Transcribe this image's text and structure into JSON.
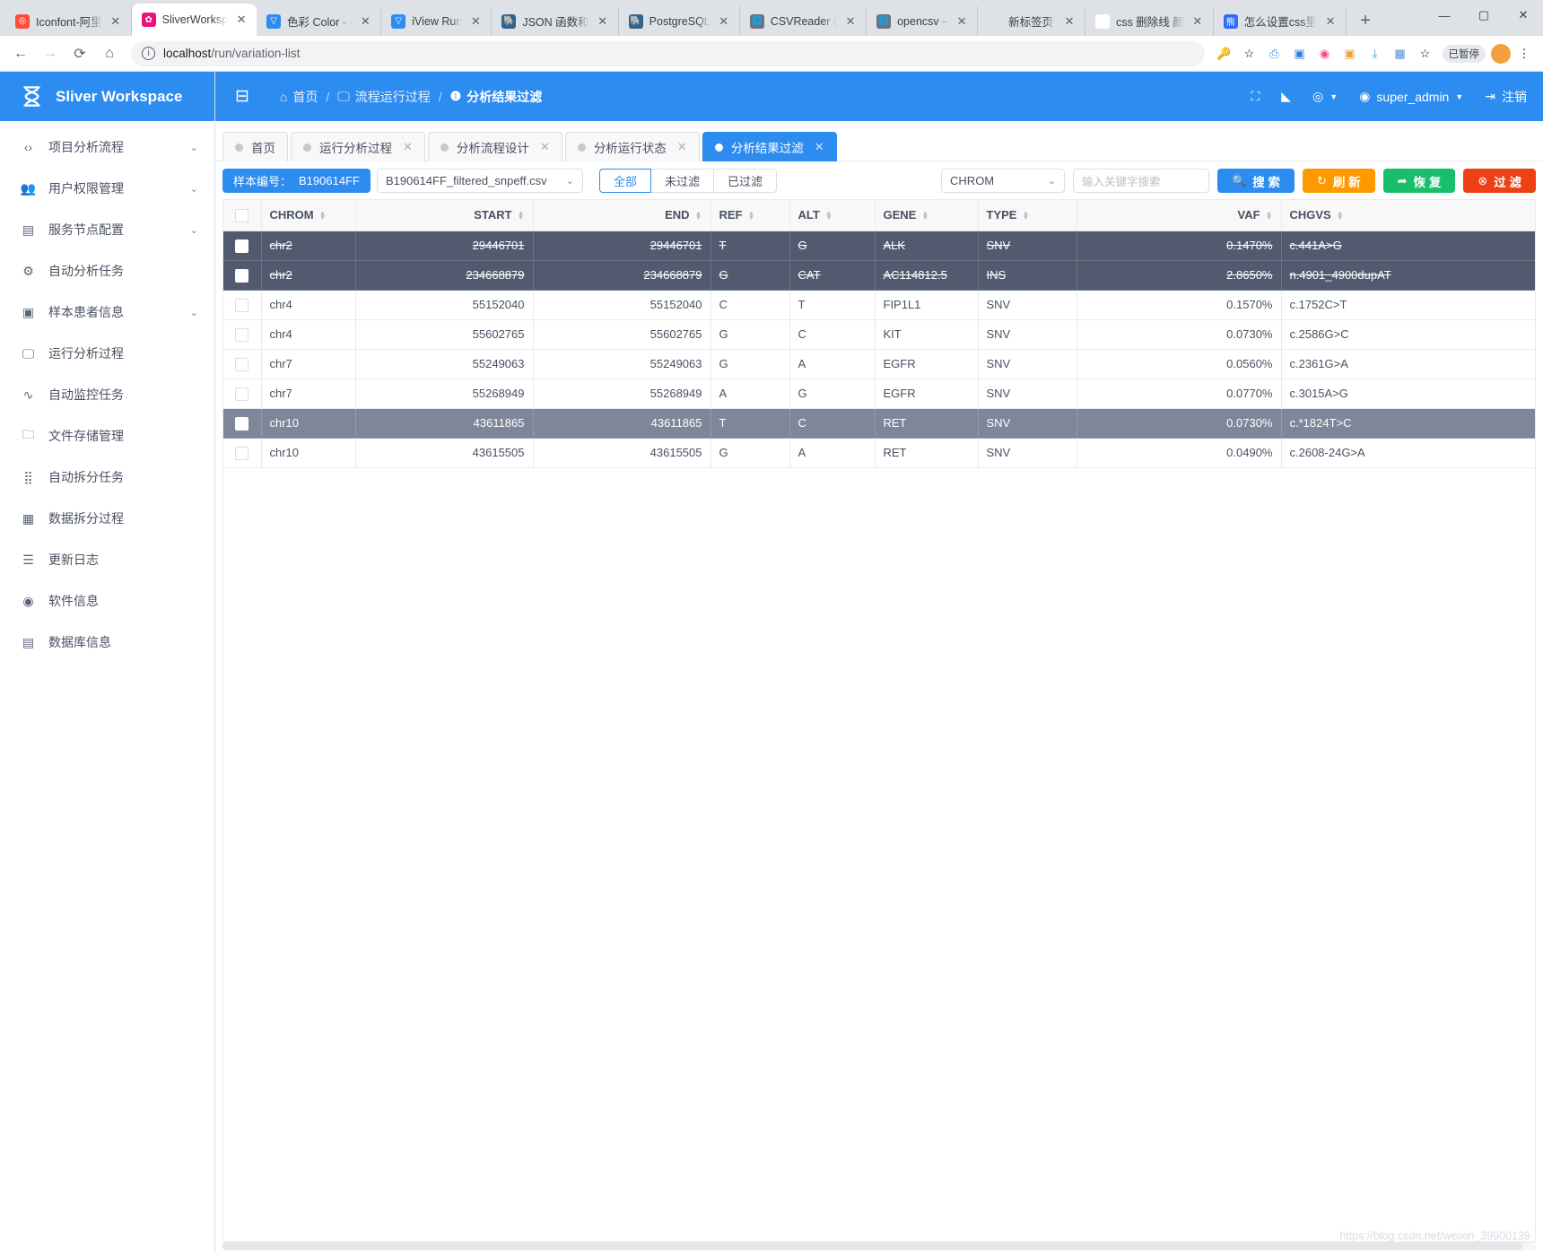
{
  "browser": {
    "tabs": [
      {
        "title": "Iconfont-阿里",
        "favicon_name": "iconfont-favicon",
        "favicon_color": "#ff4d3a",
        "favicon_glyph": "◎",
        "active": false
      },
      {
        "title": "SliverWorksp",
        "favicon_name": "sliver-favicon",
        "favicon_color": "#e8127f",
        "favicon_glyph": "✿",
        "active": true
      },
      {
        "title": "色彩 Color - i",
        "favicon_name": "iview-favicon",
        "favicon_color": "#2d8cf0",
        "favicon_glyph": "▽",
        "active": false
      },
      {
        "title": "iView Run",
        "favicon_name": "iview-favicon",
        "favicon_color": "#2d8cf0",
        "favicon_glyph": "▽",
        "active": false
      },
      {
        "title": "JSON 函数和",
        "favicon_name": "postgres-favicon",
        "favicon_color": "#31648c",
        "favicon_glyph": "🐘",
        "active": false
      },
      {
        "title": "PostgreSQL",
        "favicon_name": "postgres-favicon",
        "favicon_color": "#31648c",
        "favicon_glyph": "🐘",
        "active": false
      },
      {
        "title": "CSVReader (",
        "favicon_name": "globe-favicon",
        "favicon_color": "#6b7280",
        "favicon_glyph": "🌐",
        "active": false
      },
      {
        "title": "opencsv –",
        "favicon_name": "globe-favicon",
        "favicon_color": "#6b7280",
        "favicon_glyph": "🌐",
        "active": false
      },
      {
        "title": "新标签页",
        "favicon_name": "blank-favicon",
        "favicon_color": "#ffffff",
        "favicon_glyph": "",
        "active": false
      },
      {
        "title": "css 删除线 颜",
        "favicon_name": "google-favicon",
        "favicon_color": "#ffffff",
        "favicon_glyph": "G",
        "active": false
      },
      {
        "title": "怎么设置css里",
        "favicon_name": "baidu-favicon",
        "favicon_color": "#2e6ef7",
        "favicon_glyph": "熊",
        "active": false
      }
    ],
    "new_tab_label": "+",
    "close_glyph": "✕",
    "window_buttons": [
      "–",
      "▢",
      "✕"
    ],
    "nav": {
      "back": "←",
      "forward": "→",
      "reload": "⟳",
      "home": "⌂"
    },
    "url_main": "localhost",
    "url_path": "/run/variation-list",
    "toolbar_icons": [
      "key-icon",
      "star-icon",
      "translate-icon",
      "extension-icon",
      "dribbble-icon",
      "screenshot-icon",
      "download-icon",
      "grid-icon",
      "star-outline-icon"
    ],
    "paused_badge": "已暂停",
    "menu_glyph": "⋮"
  },
  "sidebar": {
    "brand": "Sliver Workspace",
    "items": [
      {
        "label": "项目分析流程",
        "icon": "code-icon",
        "glyph": "‹›",
        "expandable": true
      },
      {
        "label": "用户权限管理",
        "icon": "users-icon",
        "glyph": "👥",
        "expandable": true
      },
      {
        "label": "服务节点配置",
        "icon": "server-icon",
        "glyph": "▤",
        "expandable": true
      },
      {
        "label": "自动分析任务",
        "icon": "gear-icon",
        "glyph": "⚙",
        "expandable": false
      },
      {
        "label": "样本患者信息",
        "icon": "medkit-icon",
        "glyph": "▣",
        "expandable": true
      },
      {
        "label": "运行分析过程",
        "icon": "monitor-icon",
        "glyph": "🖵",
        "expandable": false
      },
      {
        "label": "自动监控任务",
        "icon": "pulse-icon",
        "glyph": "∿",
        "expandable": false
      },
      {
        "label": "文件存储管理",
        "icon": "folder-icon",
        "glyph": "🗀",
        "expandable": false
      },
      {
        "label": "自动拆分任务",
        "icon": "grid-dots-icon",
        "glyph": "⣿",
        "expandable": false
      },
      {
        "label": "数据拆分过程",
        "icon": "table-icon",
        "glyph": "▦",
        "expandable": false
      },
      {
        "label": "更新日志",
        "icon": "log-icon",
        "glyph": "☰",
        "expandable": false
      },
      {
        "label": "软件信息",
        "icon": "user-circle-icon",
        "glyph": "◉",
        "expandable": false
      },
      {
        "label": "数据库信息",
        "icon": "database-icon",
        "glyph": "▤",
        "expandable": false
      }
    ],
    "chevron": "⌄"
  },
  "topbar": {
    "collapse_icon": "menu-fold-icon",
    "breadcrumb": [
      {
        "label": "首页",
        "icon": "home-icon",
        "glyph": "⌂"
      },
      {
        "label": "流程运行过程",
        "icon": "monitor-icon",
        "glyph": "🖵"
      },
      {
        "label": "分析结果过滤",
        "icon": "info-icon",
        "glyph": "❶"
      }
    ],
    "separator": "/",
    "fullscreen_icon": "fullscreen-icon",
    "theme_icon": "paint-bucket-icon",
    "dribbble_icon": "dribbble-icon",
    "user": "super_admin",
    "user_icon": "user-circle-icon",
    "logout": "注销",
    "logout_icon": "logout-icon"
  },
  "page_tabs": [
    {
      "label": "首页",
      "closable": false,
      "selected": false
    },
    {
      "label": "运行分析过程",
      "closable": true,
      "selected": false
    },
    {
      "label": "分析流程设计",
      "closable": true,
      "selected": false
    },
    {
      "label": "分析运行状态",
      "closable": true,
      "selected": false
    },
    {
      "label": "分析结果过滤",
      "closable": true,
      "selected": true
    }
  ],
  "toolbar": {
    "sample_label": "样本编号：",
    "sample_id": "B190614FF",
    "file_select_value": "B190614FF_filtered_snpeff.csv",
    "filter_buttons": [
      {
        "label": "全部",
        "active": true
      },
      {
        "label": "未过滤",
        "active": false
      },
      {
        "label": "已过滤",
        "active": false
      }
    ],
    "column_select_value": "CHROM",
    "search_placeholder": "输入关键字搜索",
    "search_value": "",
    "actions": [
      {
        "label": "搜 索",
        "color": "blue",
        "icon": "search-icon",
        "glyph": "🔍"
      },
      {
        "label": "刷 新",
        "color": "orange",
        "icon": "refresh-icon",
        "glyph": "↻"
      },
      {
        "label": "恢 复",
        "color": "green",
        "icon": "restore-icon",
        "glyph": "➦"
      },
      {
        "label": "过 滤",
        "color": "red",
        "icon": "filter-block-icon",
        "glyph": "⊗"
      }
    ]
  },
  "table": {
    "columns": [
      {
        "key": "sel",
        "label": "",
        "align": "left"
      },
      {
        "key": "chrom",
        "label": "CHROM",
        "align": "left"
      },
      {
        "key": "start",
        "label": "START",
        "align": "right"
      },
      {
        "key": "end",
        "label": "END",
        "align": "right"
      },
      {
        "key": "ref",
        "label": "REF",
        "align": "left"
      },
      {
        "key": "alt",
        "label": "ALT",
        "align": "left"
      },
      {
        "key": "gene",
        "label": "GENE",
        "align": "left"
      },
      {
        "key": "type",
        "label": "TYPE",
        "align": "left"
      },
      {
        "key": "vaf",
        "label": "VAF",
        "align": "right"
      },
      {
        "key": "chgvs",
        "label": "CHGVS",
        "align": "left"
      }
    ],
    "header_checkbox_checked": false,
    "rows": [
      {
        "checked": true,
        "state": "struck",
        "chrom": "chr2",
        "start": "29446701",
        "end": "29446701",
        "ref": "T",
        "alt": "G",
        "gene": "ALK",
        "type": "SNV",
        "vaf": "0.1470%",
        "chgvs": "c.441A>G"
      },
      {
        "checked": true,
        "state": "struck",
        "chrom": "chr2",
        "start": "234668879",
        "end": "234668879",
        "ref": "G",
        "alt": "CAT",
        "gene": "AC114812.5",
        "type": "INS",
        "vaf": "2.8650%",
        "chgvs": "n.4901_4900dupAT"
      },
      {
        "checked": false,
        "state": "normal",
        "chrom": "chr4",
        "start": "55152040",
        "end": "55152040",
        "ref": "C",
        "alt": "T",
        "gene": "FIP1L1",
        "type": "SNV",
        "vaf": "0.1570%",
        "chgvs": "c.1752C>T"
      },
      {
        "checked": false,
        "state": "normal",
        "chrom": "chr4",
        "start": "55602765",
        "end": "55602765",
        "ref": "G",
        "alt": "C",
        "gene": "KIT",
        "type": "SNV",
        "vaf": "0.0730%",
        "chgvs": "c.2586G>C"
      },
      {
        "checked": false,
        "state": "normal",
        "chrom": "chr7",
        "start": "55249063",
        "end": "55249063",
        "ref": "G",
        "alt": "A",
        "gene": "EGFR",
        "type": "SNV",
        "vaf": "0.0560%",
        "chgvs": "c.2361G>A"
      },
      {
        "checked": false,
        "state": "normal",
        "chrom": "chr7",
        "start": "55268949",
        "end": "55268949",
        "ref": "A",
        "alt": "G",
        "gene": "EGFR",
        "type": "SNV",
        "vaf": "0.0770%",
        "chgvs": "c.3015A>G"
      },
      {
        "checked": false,
        "state": "hl",
        "chrom": "chr10",
        "start": "43611865",
        "end": "43611865",
        "ref": "T",
        "alt": "C",
        "gene": "RET",
        "type": "SNV",
        "vaf": "0.0730%",
        "chgvs": "c.*1824T>C"
      },
      {
        "checked": false,
        "state": "normal",
        "chrom": "chr10",
        "start": "43615505",
        "end": "43615505",
        "ref": "G",
        "alt": "A",
        "gene": "RET",
        "type": "SNV",
        "vaf": "0.0490%",
        "chgvs": "c.2608-24G>A"
      }
    ]
  },
  "watermark": "https://blog.csdn.net/weixin_39900139",
  "colors": {
    "primary": "#2d8cf0",
    "orange": "#ff9900",
    "green": "#19be6b",
    "red": "#ed4014",
    "row_struck": "#515a6e",
    "row_highlight": "#7f8699"
  }
}
